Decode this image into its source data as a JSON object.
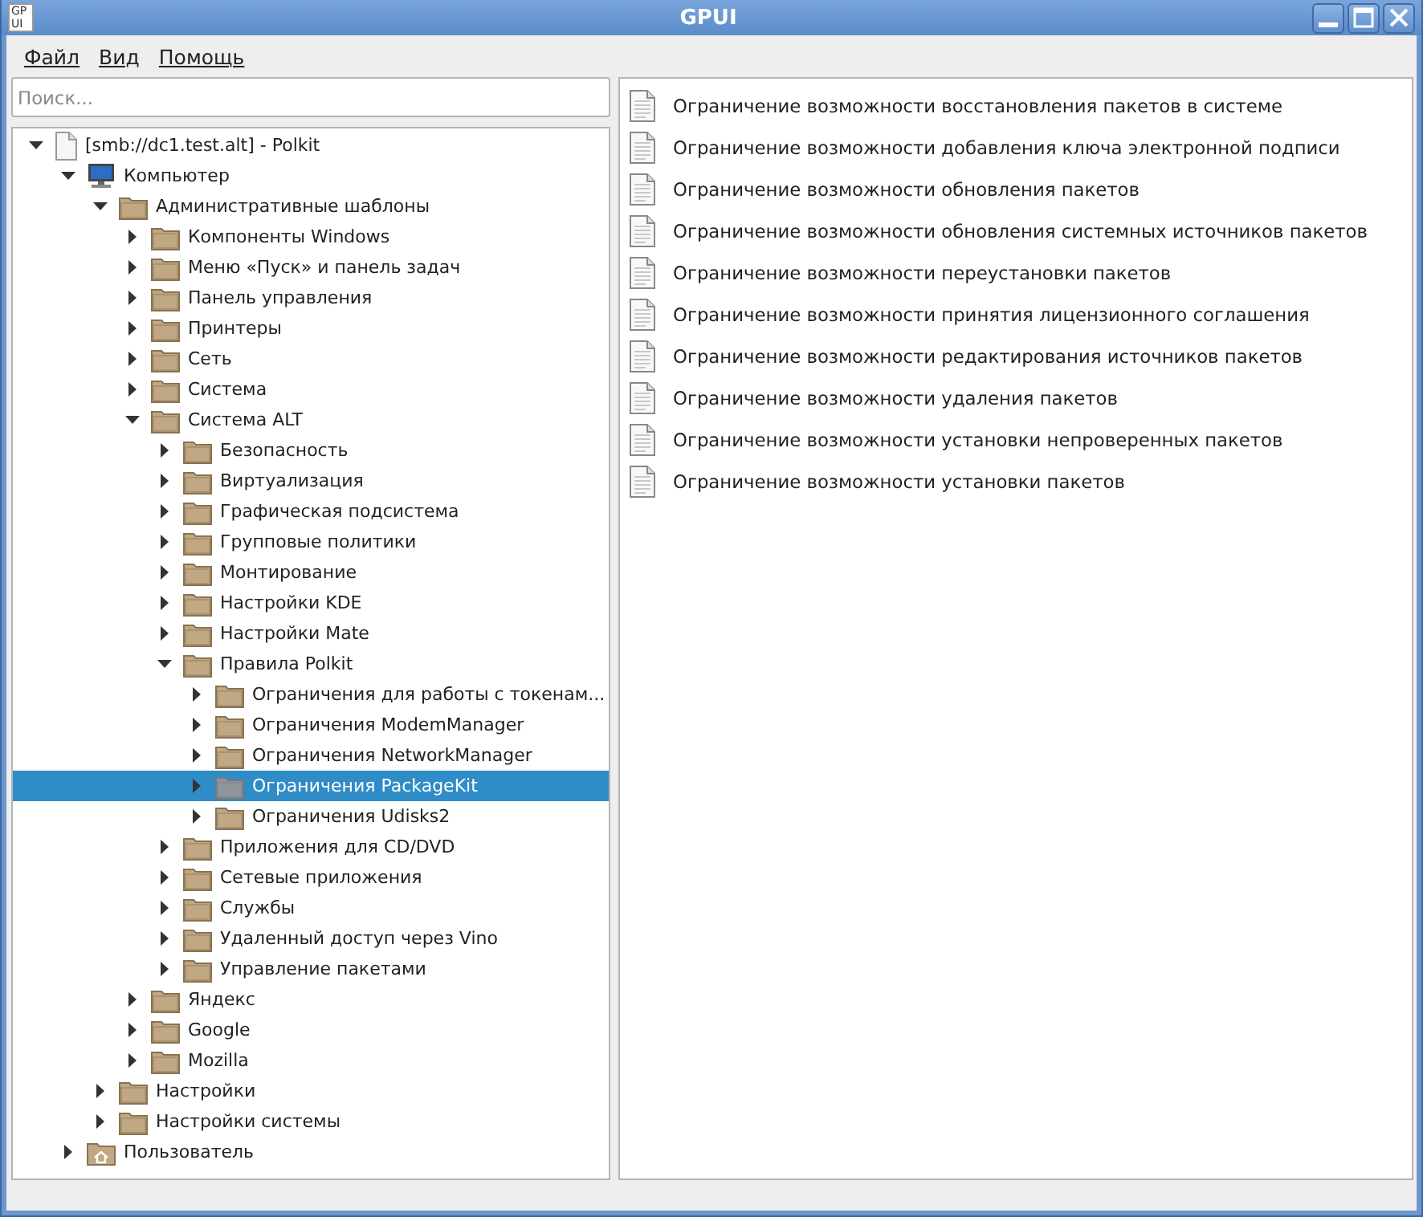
{
  "window": {
    "title": "GPUI",
    "app_icon": "GP UI"
  },
  "menu": [
    {
      "label": "Файл"
    },
    {
      "label": "Вид"
    },
    {
      "label": "Помощь"
    }
  ],
  "search": {
    "placeholder": "Поиск..."
  },
  "tree": [
    {
      "label": "[smb://dc1.test.alt] - Polkit",
      "kind": "document",
      "expanded": true,
      "selected": false,
      "children": [
        {
          "label": "Компьютер",
          "kind": "computer",
          "expanded": true,
          "selected": false,
          "children": [
            {
              "label": "Административные шаблоны",
              "kind": "folder",
              "expanded": true,
              "selected": false,
              "children": [
                {
                  "label": "Компоненты Windows",
                  "kind": "folder",
                  "expanded": false,
                  "selected": false
                },
                {
                  "label": "Меню «Пуск» и панель задач",
                  "kind": "folder",
                  "expanded": false,
                  "selected": false
                },
                {
                  "label": "Панель управления",
                  "kind": "folder",
                  "expanded": false,
                  "selected": false
                },
                {
                  "label": "Принтеры",
                  "kind": "folder",
                  "expanded": false,
                  "selected": false
                },
                {
                  "label": "Сеть",
                  "kind": "folder",
                  "expanded": false,
                  "selected": false
                },
                {
                  "label": "Система",
                  "kind": "folder",
                  "expanded": false,
                  "selected": false
                },
                {
                  "label": "Система ALT",
                  "kind": "folder",
                  "expanded": true,
                  "selected": false,
                  "children": [
                    {
                      "label": "Безопасность",
                      "kind": "folder",
                      "expanded": false,
                      "selected": false
                    },
                    {
                      "label": "Виртуализация",
                      "kind": "folder",
                      "expanded": false,
                      "selected": false
                    },
                    {
                      "label": "Графическая подсистема",
                      "kind": "folder",
                      "expanded": false,
                      "selected": false
                    },
                    {
                      "label": "Групповые политики",
                      "kind": "folder",
                      "expanded": false,
                      "selected": false
                    },
                    {
                      "label": "Монтирование",
                      "kind": "folder",
                      "expanded": false,
                      "selected": false
                    },
                    {
                      "label": "Настройки KDE",
                      "kind": "folder",
                      "expanded": false,
                      "selected": false
                    },
                    {
                      "label": "Настройки Mate",
                      "kind": "folder",
                      "expanded": false,
                      "selected": false
                    },
                    {
                      "label": "Правила Polkit",
                      "kind": "folder",
                      "expanded": true,
                      "selected": false,
                      "children": [
                        {
                          "label": "Ограничения для работы с токенам...",
                          "kind": "folder",
                          "expanded": false,
                          "selected": false
                        },
                        {
                          "label": "Ограничения ModemManager",
                          "kind": "folder",
                          "expanded": false,
                          "selected": false
                        },
                        {
                          "label": "Ограничения NetworkManager",
                          "kind": "folder",
                          "expanded": false,
                          "selected": false
                        },
                        {
                          "label": "Ограничения PackageKit",
                          "kind": "folder",
                          "expanded": false,
                          "selected": true
                        },
                        {
                          "label": "Ограничения Udisks2",
                          "kind": "folder",
                          "expanded": false,
                          "selected": false
                        }
                      ]
                    },
                    {
                      "label": "Приложения для CD/DVD",
                      "kind": "folder",
                      "expanded": false,
                      "selected": false
                    },
                    {
                      "label": "Сетевые приложения",
                      "kind": "folder",
                      "expanded": false,
                      "selected": false
                    },
                    {
                      "label": "Службы",
                      "kind": "folder",
                      "expanded": false,
                      "selected": false
                    },
                    {
                      "label": "Удаленный доступ через Vino",
                      "kind": "folder",
                      "expanded": false,
                      "selected": false
                    },
                    {
                      "label": "Управление пакетами",
                      "kind": "folder",
                      "expanded": false,
                      "selected": false
                    }
                  ]
                },
                {
                  "label": "Яндекс",
                  "kind": "folder",
                  "expanded": false,
                  "selected": false
                },
                {
                  "label": "Google",
                  "kind": "folder",
                  "expanded": false,
                  "selected": false
                },
                {
                  "label": "Mozilla",
                  "kind": "folder",
                  "expanded": false,
                  "selected": false
                }
              ]
            },
            {
              "label": "Настройки",
              "kind": "folder",
              "expanded": false,
              "selected": false
            },
            {
              "label": "Настройки системы",
              "kind": "folder",
              "expanded": false,
              "selected": false
            }
          ]
        },
        {
          "label": "Пользователь",
          "kind": "user-folder",
          "expanded": false,
          "selected": false
        }
      ]
    }
  ],
  "policies": [
    {
      "label": "Ограничение возможности восстановления пакетов в системе"
    },
    {
      "label": "Ограничение возможности добавления ключа электронной подписи"
    },
    {
      "label": "Ограничение возможности обновления пакетов"
    },
    {
      "label": "Ограничение возможности обновления системных источников пакетов"
    },
    {
      "label": "Ограничение возможности переустановки пакетов"
    },
    {
      "label": "Ограничение возможности принятия лицензионного соглашения"
    },
    {
      "label": "Ограничение возможности редактирования источников пакетов"
    },
    {
      "label": "Ограничение возможности удаления пакетов"
    },
    {
      "label": "Ограничение возможности установки непроверенных пакетов"
    },
    {
      "label": "Ограничение возможности установки пакетов"
    }
  ]
}
